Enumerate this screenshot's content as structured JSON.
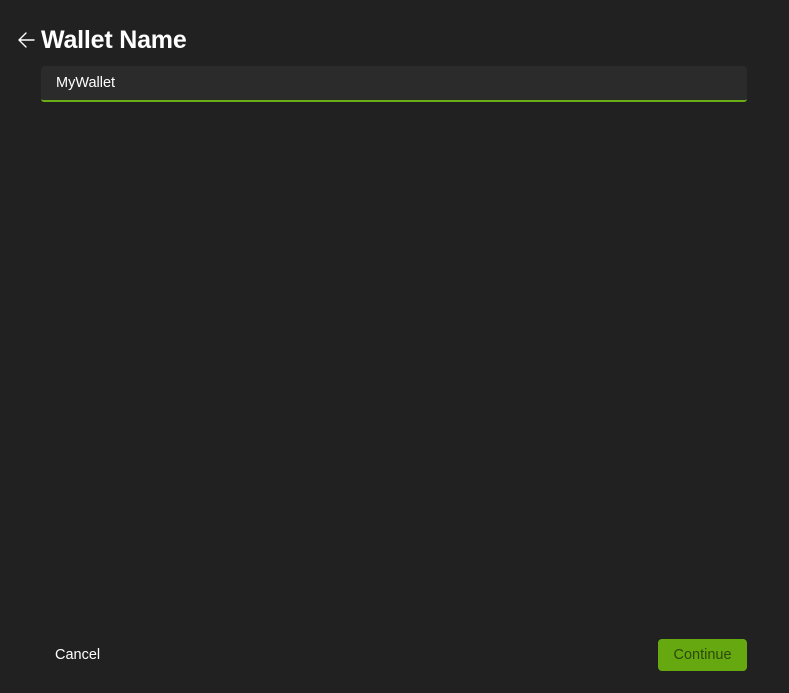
{
  "header": {
    "title": "Wallet Name",
    "back_icon": "arrow-left-icon"
  },
  "wallet_name_field": {
    "value": "MyWallet",
    "accent_color": "#6aae17"
  },
  "footer": {
    "cancel_label": "Cancel",
    "continue_label": "Continue",
    "continue_color": "#66a80f"
  }
}
